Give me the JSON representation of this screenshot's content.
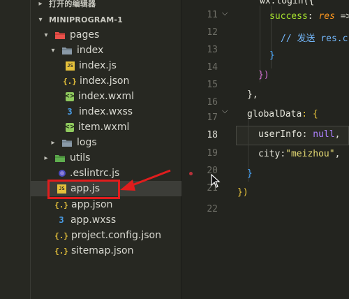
{
  "explorer": {
    "open_editors_label": "打开的编辑器",
    "project_name": "MINIPROGRAM-1",
    "items": [
      {
        "label": "pages",
        "kind": "folder-red",
        "open": true
      },
      {
        "label": "index",
        "kind": "folder",
        "open": true
      },
      {
        "label": "index.js",
        "kind": "js"
      },
      {
        "label": "index.json",
        "kind": "json"
      },
      {
        "label": "index.wxml",
        "kind": "wxml"
      },
      {
        "label": "index.wxss",
        "kind": "css"
      },
      {
        "label": "item.wxml",
        "kind": "wxml"
      },
      {
        "label": "logs",
        "kind": "folder",
        "open": false
      },
      {
        "label": "utils",
        "kind": "folder-green",
        "open": false
      },
      {
        "label": ".eslintrc.js",
        "kind": "eslint"
      },
      {
        "label": "app.js",
        "kind": "js",
        "selected": true
      },
      {
        "label": "app.json",
        "kind": "json"
      },
      {
        "label": "app.wxss",
        "kind": "css"
      },
      {
        "label": "project.config.json",
        "kind": "json"
      },
      {
        "label": "sitemap.json",
        "kind": "json"
      }
    ]
  },
  "editor": {
    "lines": [
      {
        "no": "11",
        "text_a": "wx.login({"
      },
      {
        "no": "12",
        "key": "success",
        "colon": ": ",
        "param": "res",
        "rest": " =>"
      },
      {
        "no": "13",
        "comment": "// 发送 res.c"
      },
      {
        "no": "14",
        "text_a": "}"
      },
      {
        "no": "15",
        "text_a": "})"
      },
      {
        "no": "16",
        "text_a": "},"
      },
      {
        "no": "17",
        "key": "globalData",
        "rest": ": {"
      },
      {
        "no": "18",
        "key": "userInfo",
        "rest": ": ",
        "null_word": "null",
        "end": ","
      },
      {
        "no": "19",
        "key": "city",
        "rest": ":",
        "string": "\"meizhou\"",
        "end": ","
      },
      {
        "no": "20",
        "text_a": "}"
      },
      {
        "no": "21",
        "text_a": "})"
      },
      {
        "no": "22",
        "text_a": ""
      }
    ]
  },
  "colors": {
    "highlight": "#e01d1d",
    "sidebar_bg": "#272822",
    "editor_bg": "#23241f"
  },
  "icons": {
    "fold": "chevron-down-icon",
    "cursor": "mouse-pointer-icon"
  }
}
